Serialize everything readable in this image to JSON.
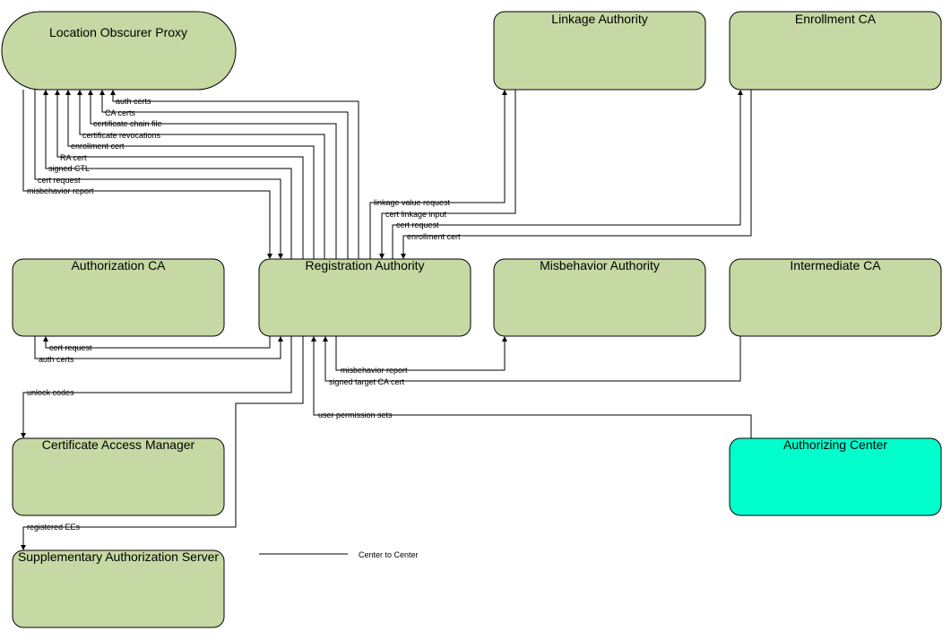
{
  "colors": {
    "node_fill": "#c6d8a3",
    "highlight_fill": "#00ffcc",
    "line": "#000000"
  },
  "nodes": {
    "location_obscurer_proxy": "Location Obscurer Proxy",
    "linkage_authority": "Linkage Authority",
    "enrollment_ca": "Enrollment CA",
    "authorization_ca": "Authorization CA",
    "registration_authority": "Registration Authority",
    "misbehavior_authority": "Misbehavior Authority",
    "intermediate_ca": "Intermediate CA",
    "certificate_access_manager": "Certificate Access Manager",
    "authorizing_center": "Authorizing Center",
    "supplementary_authorization_server": "Supplementary Authorization Server"
  },
  "flows": {
    "auth_certs_lop": "auth certs",
    "ca_certs": "CA certs",
    "certificate_chain_file": "certificate chain file",
    "certificate_revocations": "certificate revocations",
    "enrollment_cert_lop": "enrollment cert",
    "ra_cert": "RA cert",
    "signed_ctl": "signed CTL",
    "cert_request_lop": "cert request",
    "misbehavior_report_lop": "misbehavior report",
    "linkage_value_request": "linkage value request",
    "cert_linkage_input": "cert linkage input",
    "cert_request_eca": "cert request",
    "enrollment_cert_eca": "enrollment cert",
    "cert_request_aca": "cert request",
    "auth_certs_aca": "auth certs",
    "misbehavior_report_ma": "misbehavior report",
    "signed_target_ca_cert": "signed target CA cert",
    "unlock_codes": "unlock codes",
    "user_permission_sets": "user permission sets",
    "registered_ees": "registered EEs"
  },
  "legend": {
    "center_to_center": "Center to Center"
  }
}
